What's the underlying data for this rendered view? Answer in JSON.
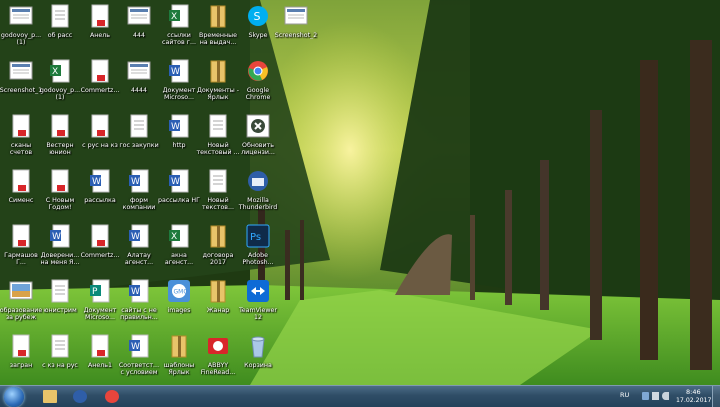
{
  "wallpaper": {
    "description_hidden": ""
  },
  "icons": [
    {
      "label": "godovoy_p...\n(1)",
      "icon": "screenshot-thumb-icon",
      "color": "#dde3ea"
    },
    {
      "label": "Screenshot_1",
      "icon": "screenshot-thumb-icon",
      "color": "#dde3ea"
    },
    {
      "label": "сканы\nсчетов",
      "icon": "pdf-doc-icon",
      "color": "#ffffff"
    },
    {
      "label": "Сименс",
      "icon": "pdf-doc-icon",
      "color": "#ffffff"
    },
    {
      "label": "Гармашов Г...\nсчета",
      "icon": "pdf-doc-icon",
      "color": "#ffffff"
    },
    {
      "label": "образование\nза рубеж",
      "icon": "image-thumb-icon",
      "color": "#6fa3d9"
    },
    {
      "label": "загран",
      "icon": "pdf-doc-icon",
      "color": "#ffffff"
    },
    {
      "label": "об расс",
      "icon": "document-icon",
      "color": "#ffffff"
    },
    {
      "label": "godovoy_p...\n(1)",
      "icon": "excel-doc-icon",
      "color": "#ffffff"
    },
    {
      "label": "Вестерн\nюнион",
      "icon": "pdf-doc-icon",
      "color": "#ffffff"
    },
    {
      "label": "С Новым\nГодом!",
      "icon": "pdf-doc-icon",
      "color": "#ffffff"
    },
    {
      "label": "Доверени...\nна меня Я...",
      "icon": "word-doc-icon",
      "color": "#ffffff"
    },
    {
      "label": "юнистрим",
      "icon": "document-icon",
      "color": "#ffffff"
    },
    {
      "label": "с кз на рус",
      "icon": "document-icon",
      "color": "#ffffff"
    },
    {
      "label": "Анель",
      "icon": "pdf-doc-icon",
      "color": "#ffffff"
    },
    {
      "label": "Commertz...",
      "icon": "pdf-doc-icon",
      "color": "#ffffff"
    },
    {
      "label": "с рус на кз",
      "icon": "pdf-doc-icon",
      "color": "#ffffff"
    },
    {
      "label": "рассылка",
      "icon": "word-doc-icon",
      "color": "#ffffff"
    },
    {
      "label": "Commertz...",
      "icon": "pdf-doc-icon",
      "color": "#ffffff"
    },
    {
      "label": "Документ\nMicroso...",
      "icon": "publisher-doc-icon",
      "color": "#ffffff"
    },
    {
      "label": "Анель1",
      "icon": "pdf-doc-icon",
      "color": "#ffffff"
    },
    {
      "label": "444",
      "icon": "screenshot-thumb-icon",
      "color": "#dde3ea"
    },
    {
      "label": "4444",
      "icon": "screenshot-thumb-icon",
      "color": "#dde3ea"
    },
    {
      "label": "гос закупки",
      "icon": "document-icon",
      "color": "#ffffff"
    },
    {
      "label": "форм\nкомпании",
      "icon": "word-doc-icon",
      "color": "#ffffff"
    },
    {
      "label": "Алатау\nагенст...",
      "icon": "word-doc-icon",
      "color": "#ffffff"
    },
    {
      "label": "сайты с не\nправильн...",
      "icon": "word-doc-icon",
      "color": "#ffffff"
    },
    {
      "label": "Соответст...\nс условием",
      "icon": "word-doc-icon",
      "color": "#ffffff"
    },
    {
      "label": "ссылки\nсайтов г...",
      "icon": "excel-doc-icon",
      "color": "#ffffff"
    },
    {
      "label": "Документ\nMicroso...",
      "icon": "word-doc-icon",
      "color": "#ffffff"
    },
    {
      "label": "http",
      "icon": "word-doc-icon",
      "color": "#ffffff"
    },
    {
      "label": "рассылка НГ",
      "icon": "word-doc-icon",
      "color": "#ffffff"
    },
    {
      "label": "акна\nагенст...",
      "icon": "excel-doc-icon",
      "color": "#ffffff"
    },
    {
      "label": "images",
      "icon": "gmo-app-icon",
      "color": "#4a90d9"
    },
    {
      "label": "шаблоны\nЯрлык",
      "icon": "folder-shortcut-icon",
      "color": "#e8c46a"
    },
    {
      "label": "Временные\nна выдач...",
      "icon": "folder-zip-icon",
      "color": "#e8c46a"
    },
    {
      "label": "Документы -\nЯрлык",
      "icon": "folder-zip-icon",
      "color": "#e8c46a"
    },
    {
      "label": "Новый\nтекстовый ...",
      "icon": "text-doc-icon",
      "color": "#ffffff"
    },
    {
      "label": "Новый\nтекстов...",
      "icon": "text-doc-icon",
      "color": "#ffffff"
    },
    {
      "label": "договора\n2017",
      "icon": "folder-icon",
      "color": "#e8c46a"
    },
    {
      "label": "Жанар",
      "icon": "folder-zip-icon",
      "color": "#e8c46a"
    },
    {
      "label": "ABBYY\nFineRead...",
      "icon": "abbyy-app-icon",
      "color": "#d8262a"
    },
    {
      "label": "Skype",
      "icon": "skype-app-icon",
      "color": "#00aff0"
    },
    {
      "label": "Google\nChrome",
      "icon": "chrome-app-icon",
      "color": "#e8453c"
    },
    {
      "label": "Обновить\nлицензи...",
      "icon": "kaspersky-app-icon",
      "color": "#3a4a3a"
    },
    {
      "label": "Mozilla\nThunderbird",
      "icon": "thunderbird-app-icon",
      "color": "#2f5ea8"
    },
    {
      "label": "Adobe\nPhotosh...",
      "icon": "photoshop-app-icon",
      "color": "#0f2b4a"
    },
    {
      "label": "TeamViewer\n12",
      "icon": "teamviewer-app-icon",
      "color": "#0e6bd6"
    },
    {
      "label": "Корзина",
      "icon": "recycle-bin-icon",
      "color": "#aac8e8"
    },
    {
      "label": "Screenshot_2",
      "icon": "screenshot-thumb-icon",
      "color": "#cfd6de"
    }
  ],
  "taskbar": {
    "apps": [
      {
        "icon": "explorer-icon",
        "color": "#e8c46a"
      },
      {
        "icon": "thunderbird-icon",
        "color": "#2f5ea8"
      },
      {
        "icon": "chrome-icon",
        "color": "#e8453c"
      }
    ],
    "language": "RU",
    "time": "8:46",
    "date": "17.02.2017"
  }
}
